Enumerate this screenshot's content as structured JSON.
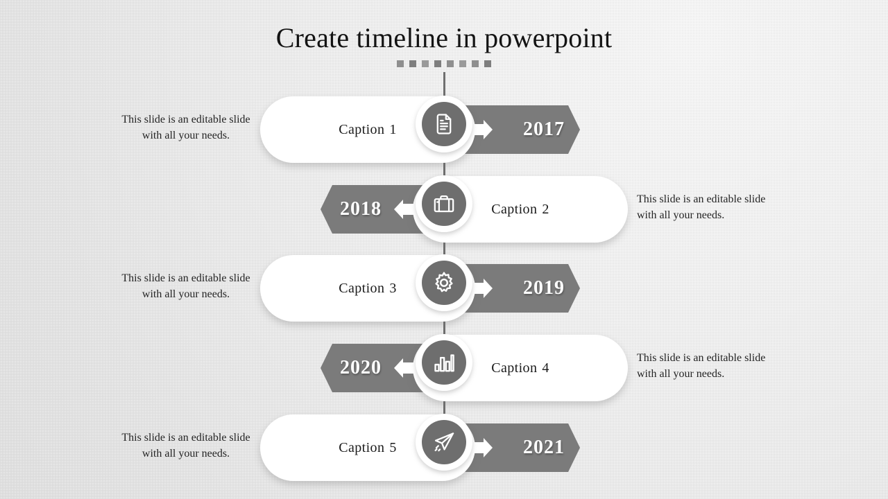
{
  "title": "Create timeline in powerpoint",
  "title_dots_count": 8,
  "colors": {
    "banner": "#7b7b7b",
    "node_circle": "#6e6e6e",
    "pill": "#ffffff",
    "spine": "#6f6f6f",
    "title_text": "#131313",
    "year_text": "#ffffff"
  },
  "rows": [
    {
      "side": "left",
      "caption_label": "Caption",
      "caption_number": "1",
      "year": "2017",
      "icon": "document-icon",
      "arrow": "arrow-right-icon",
      "description": "This slide is an editable slide with all your needs."
    },
    {
      "side": "right",
      "caption_label": "Caption",
      "caption_number": "2",
      "year": "2018",
      "icon": "briefcase-icon",
      "arrow": "arrow-left-icon",
      "description": "This slide is an editable slide with all your needs."
    },
    {
      "side": "left",
      "caption_label": "Caption",
      "caption_number": "3",
      "year": "2019",
      "icon": "gear-icon",
      "arrow": "arrow-right-icon",
      "description": "This slide is an editable slide with all your needs."
    },
    {
      "side": "right",
      "caption_label": "Caption",
      "caption_number": "4",
      "year": "2020",
      "icon": "bar-chart-icon",
      "arrow": "arrow-left-icon",
      "description": "This slide is an editable slide with all your needs."
    },
    {
      "side": "left",
      "caption_label": "Caption",
      "caption_number": "5",
      "year": "2021",
      "icon": "paper-plane-icon",
      "arrow": "arrow-right-icon",
      "description": "This slide is an editable slide with all your needs."
    }
  ]
}
